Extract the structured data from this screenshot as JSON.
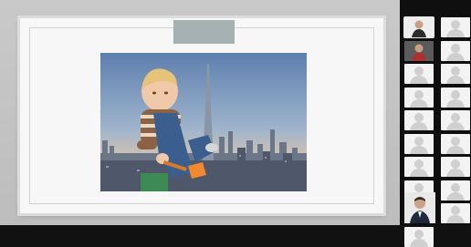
{
  "meeting": {
    "share": {
      "slide_tab": "",
      "photo": {
        "subject": "toddler-in-overalls",
        "background": "city-skyline-with-tower"
      }
    },
    "gallery": {
      "columns": 2,
      "tiles": [
        {
          "col": 0,
          "kind": "video",
          "person": "participant-1"
        },
        {
          "col": 1,
          "kind": "avatar"
        },
        {
          "col": 0,
          "kind": "video",
          "person": "participant-2"
        },
        {
          "col": 1,
          "kind": "avatar"
        },
        {
          "col": 0,
          "kind": "avatar"
        },
        {
          "col": 1,
          "kind": "avatar"
        },
        {
          "col": 0,
          "kind": "avatar"
        },
        {
          "col": 1,
          "kind": "avatar"
        },
        {
          "col": 0,
          "kind": "avatar"
        },
        {
          "col": 1,
          "kind": "avatar"
        },
        {
          "col": 0,
          "kind": "avatar"
        },
        {
          "col": 1,
          "kind": "avatar"
        },
        {
          "col": 0,
          "kind": "avatar"
        },
        {
          "col": 1,
          "kind": "avatar"
        },
        {
          "col": 0,
          "kind": "avatar"
        },
        {
          "col": 1,
          "kind": "avatar"
        },
        {
          "col": 0,
          "kind": "avatar"
        },
        {
          "col": 1,
          "kind": "avatar"
        },
        {
          "col": 0,
          "kind": "avatar"
        }
      ],
      "self_view": {
        "kind": "video",
        "person": "presenter"
      }
    },
    "colors": {
      "frame_bg": "#c4c4c4",
      "slide_bg": "#f7f7f7",
      "slide_tab": "#a6b1b3",
      "gallery_bg": "#0f0f0f",
      "avatar_tile": "#f3f3f3",
      "avatar_glyph": "#cfcfcf"
    },
    "icons": [
      "person-placeholder-icon"
    ]
  }
}
